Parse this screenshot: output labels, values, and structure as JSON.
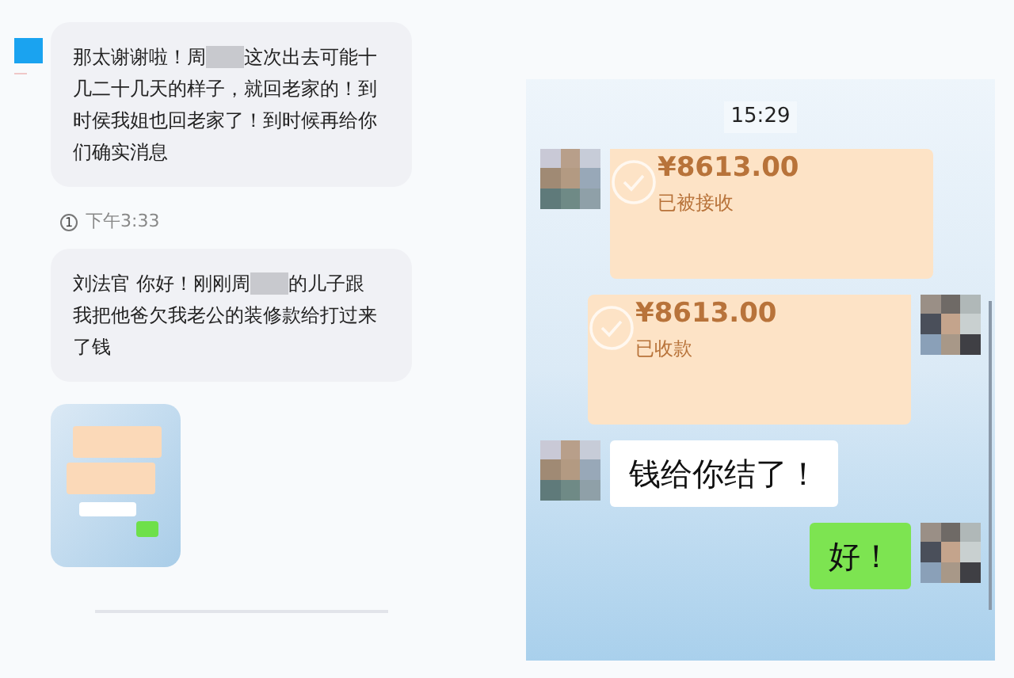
{
  "left_chat": {
    "messages": [
      {
        "kind": "text",
        "lines": [
          [
            {
              "kind": "text",
              "text": "那太谢谢啦！周"
            },
            {
              "kind": "redacted"
            },
            {
              "kind": "text",
              "text": "这次出去可能十"
            }
          ],
          [
            {
              "kind": "text",
              "text": "几二十几天的样子，就回老家的！到"
            }
          ],
          [
            {
              "kind": "text",
              "text": "时侯我姐也回老家了！到时候再给你"
            }
          ],
          [
            {
              "kind": "text",
              "text": "们确实消息"
            }
          ]
        ]
      },
      {
        "kind": "time",
        "badge": "1",
        "text": "下午3:33"
      },
      {
        "kind": "text",
        "lines": [
          [
            {
              "kind": "text",
              "text": "刘法官 你好！刚刚周"
            },
            {
              "kind": "redacted"
            },
            {
              "kind": "text",
              "text": "的儿子跟"
            }
          ],
          [
            {
              "kind": "text",
              "text": "我把他爸欠我老公的装修款给打过来"
            }
          ],
          [
            {
              "kind": "text",
              "text": "了钱"
            }
          ]
        ]
      },
      {
        "kind": "image"
      }
    ]
  },
  "screenshot": {
    "time": "15:29",
    "messages": [
      {
        "kind": "transfer",
        "outgoing": false,
        "amount": "¥8613.00",
        "status": "已被接收"
      },
      {
        "kind": "transfer",
        "outgoing": true,
        "amount": "¥8613.00",
        "status": "已收款"
      },
      {
        "kind": "text",
        "outgoing": false,
        "text": "钱给你结了！"
      },
      {
        "kind": "text",
        "outgoing": true,
        "text": "好！"
      }
    ]
  }
}
